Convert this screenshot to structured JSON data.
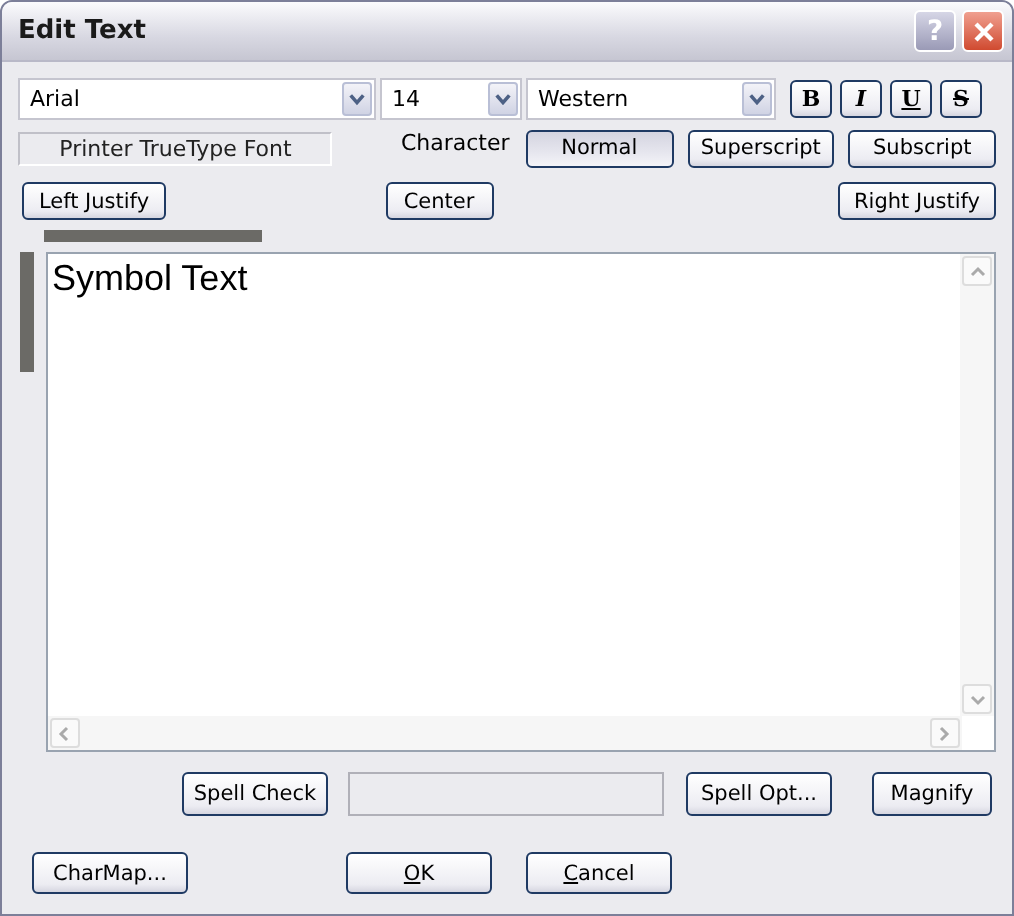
{
  "window": {
    "title": "Edit Text",
    "help": "?"
  },
  "font_bar": {
    "font": "Arial",
    "size": "14",
    "script": "Western",
    "styles": [
      {
        "kind": "bold",
        "label": "B"
      },
      {
        "kind": "italic",
        "label": "I"
      },
      {
        "kind": "underline",
        "label": "U"
      },
      {
        "kind": "strike",
        "label": "S"
      }
    ]
  },
  "font_type": "Printer TrueType Font",
  "character": {
    "label": "Character",
    "modes": [
      {
        "label": "Normal",
        "selected": true
      },
      {
        "label": "Superscript",
        "selected": false
      },
      {
        "label": "Subscript",
        "selected": false
      }
    ]
  },
  "justify": [
    "Left Justify",
    "Center",
    "Right Justify"
  ],
  "editor": {
    "text": "Symbol Text"
  },
  "spell": {
    "check": "Spell Check",
    "options": "Spell Opt...",
    "magnify": "Magnify"
  },
  "footer": {
    "charmap": "CharMap...",
    "ok": {
      "accel": "O",
      "rest": "K"
    },
    "cancel": {
      "accel": "C",
      "rest": "ancel"
    }
  }
}
